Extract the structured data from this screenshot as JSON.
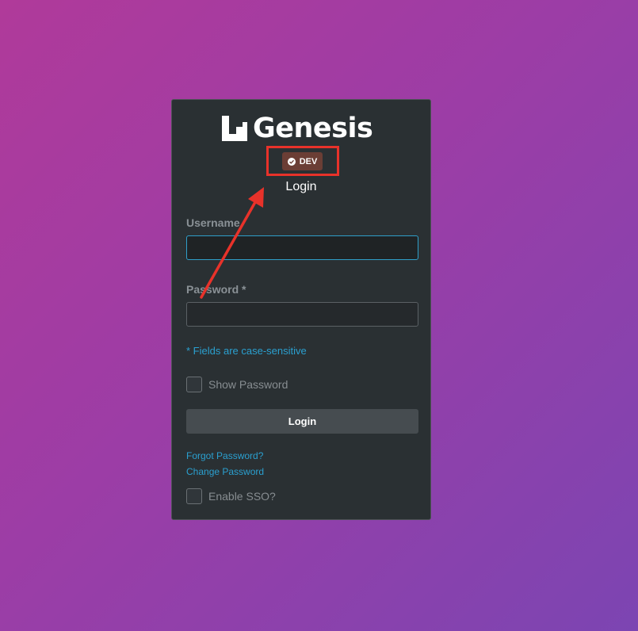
{
  "brand": {
    "logo_text": "Genesis",
    "logo_icon": "genesis-logo-icon"
  },
  "environment_badge": {
    "label": "DEV",
    "icon": "check-circle-icon",
    "color": "#6b3e35"
  },
  "login_form": {
    "title": "Login",
    "username": {
      "label": "Username",
      "value": "",
      "placeholder": ""
    },
    "password": {
      "label": "Password *",
      "value": "",
      "placeholder": ""
    },
    "case_hint": "* Fields are case-sensitive",
    "show_password": {
      "label": "Show Password",
      "checked": false
    },
    "submit_label": "Login",
    "forgot_password_link": "Forgot Password?",
    "change_password_link": "Change Password",
    "enable_sso": {
      "label": "Enable SSO?",
      "checked": false
    }
  },
  "annotation": {
    "highlight_color": "#e8322a",
    "target": "environment_badge"
  },
  "colors": {
    "card_background": "#2a3033",
    "accent": "#2aa0d0",
    "button_background": "#464c50"
  }
}
